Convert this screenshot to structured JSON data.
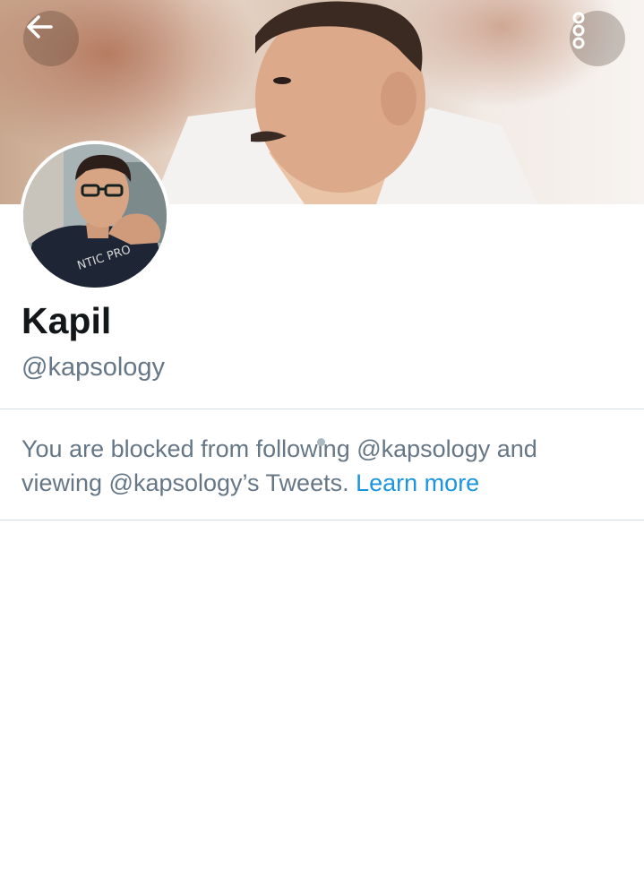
{
  "header": {
    "back_icon": "arrow-left-icon",
    "more_icon": "more-vertical-icon"
  },
  "profile": {
    "display_name": "Kapil",
    "handle": "@kapsology"
  },
  "blocked_notice": {
    "message": "You are blocked from following @kapsology and viewing @kapsology’s Tweets.",
    "link_label": "Learn more",
    "link_color": "#1b95e0"
  },
  "colors": {
    "secondary_text": "#657786",
    "divider": "#d3dde2"
  }
}
